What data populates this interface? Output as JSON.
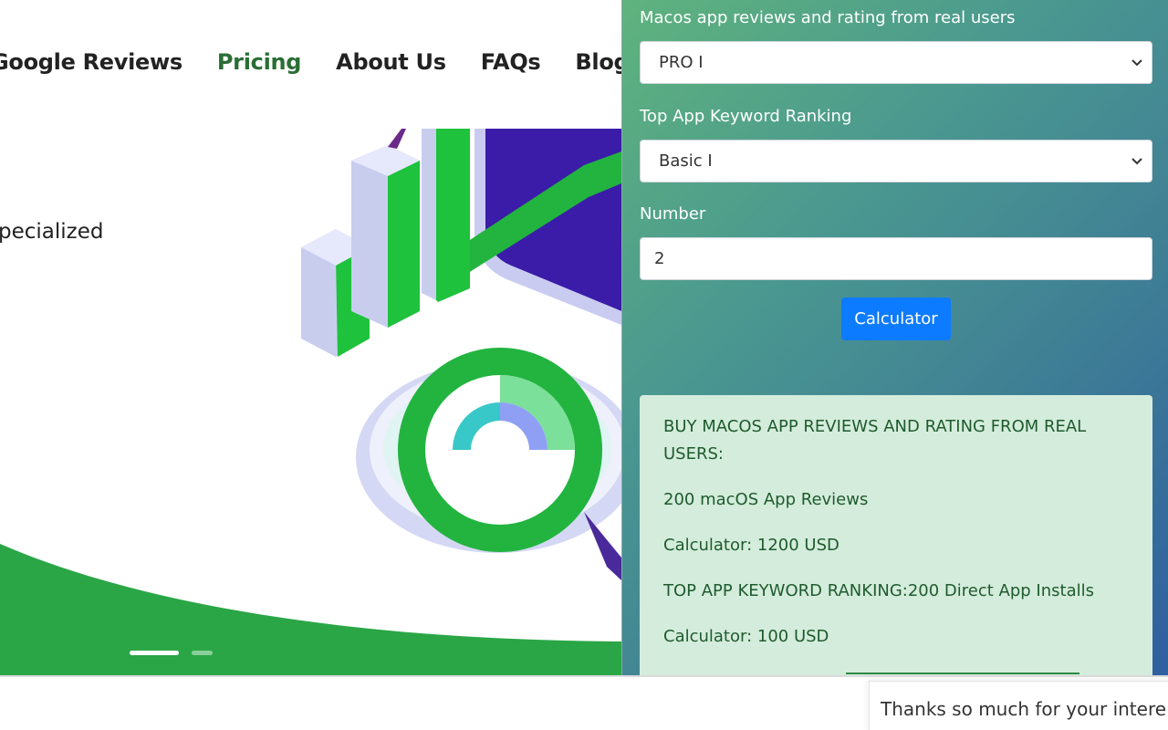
{
  "nav": {
    "items": [
      {
        "label": "Google Reviews",
        "active": false
      },
      {
        "label": "Pricing",
        "active": true
      },
      {
        "label": "About Us",
        "active": false
      },
      {
        "label": "FAQs",
        "active": false
      },
      {
        "label": "Blog",
        "active": false
      }
    ]
  },
  "hero": {
    "text": "pecialized",
    "slides": {
      "count": 2,
      "active_index": 0
    }
  },
  "calculator": {
    "field1": {
      "label": "Macos app reviews and rating from real users",
      "value": "PRO I"
    },
    "field2": {
      "label": "Top App Keyword Ranking",
      "value": "Basic I"
    },
    "field3": {
      "label": "Number",
      "value": "2"
    },
    "button_label": "Calculator",
    "result": {
      "line1": "BUY MACOS APP REVIEWS AND RATING FROM REAL USERS:",
      "line2": "200 macOS App Reviews",
      "line3": "Calculator: 1200 USD",
      "line4": "TOP APP KEYWORD RANKING:200 Direct App Installs",
      "line5": "Calculator: 100 USD"
    }
  },
  "toast": {
    "text": "Thanks so much for your intere"
  },
  "colors": {
    "accent_green": "#2a6e35",
    "hero_green": "#2aa646",
    "button_blue": "#0d7bff",
    "result_bg": "#d4ecdb",
    "result_text": "#1e5b2e"
  }
}
